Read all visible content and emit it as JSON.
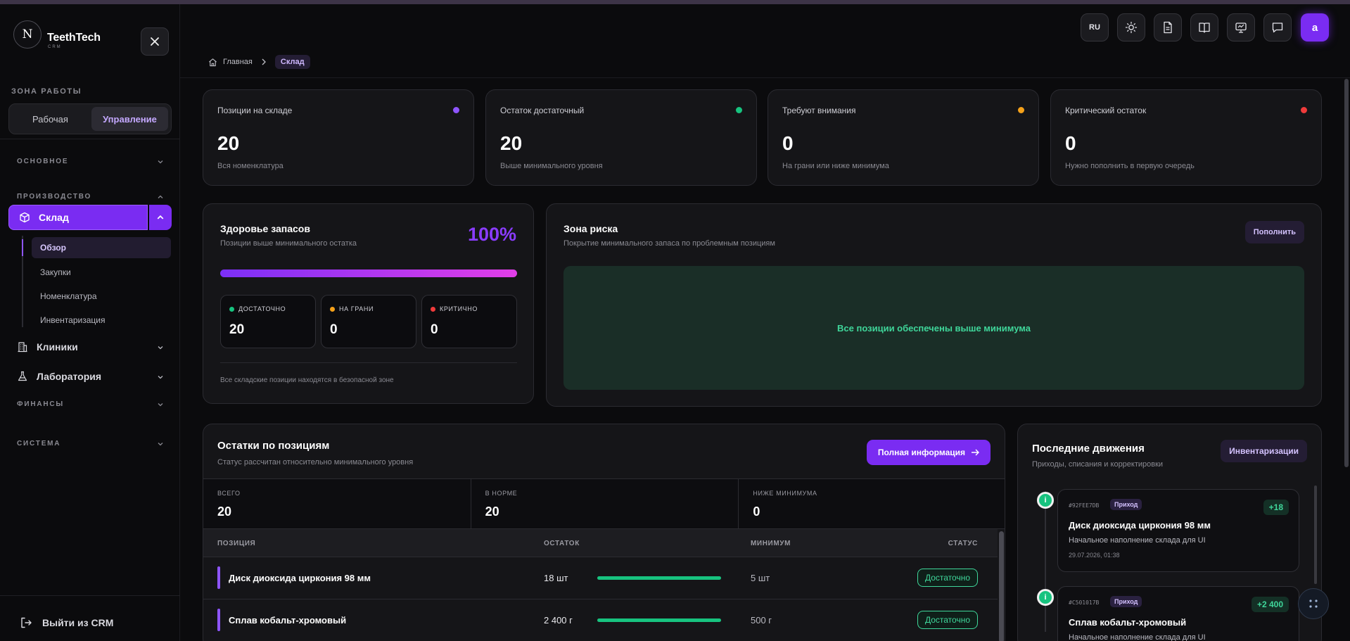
{
  "brand": {
    "name": "TeethTech",
    "sub": "CRM",
    "logo_letter": "N"
  },
  "sidebar": {
    "zone_title": "ЗОНА РАБОТЫ",
    "zone_tabs": [
      {
        "label": "Рабочая"
      },
      {
        "label": "Управление",
        "active": true
      }
    ],
    "groups": {
      "basic": "ОСНОВНОЕ",
      "production": "ПРОИЗВОДСТВО",
      "finance": "ФИНАНСЫ",
      "system": "СИСТЕМА"
    },
    "active_section": "Склад",
    "sub_items": [
      {
        "label": "Обзор",
        "active": true
      },
      {
        "label": "Закупки"
      },
      {
        "label": "Номенклатура"
      },
      {
        "label": "Инвентаризация"
      }
    ],
    "clinics": "Клиники",
    "laboratory": "Лаборатория",
    "logout": "Выйти из CRM"
  },
  "header": {
    "lang": "RU",
    "avatar_letter": "a",
    "icons": [
      "sun-icon",
      "document-icon",
      "book-icon",
      "monitor-icon",
      "chat-icon"
    ]
  },
  "breadcrumb": {
    "home": "Главная",
    "current": "Склад"
  },
  "stats": [
    {
      "label": "Позиции на складе",
      "value": "20",
      "hint": "Вся номенклатура",
      "color": "#8e55ff"
    },
    {
      "label": "Остаток достаточный",
      "value": "20",
      "hint": "Выше минимального уровня",
      "color": "#17c37f"
    },
    {
      "label": "Требуют внимания",
      "value": "0",
      "hint": "На грани или ниже минимума",
      "color": "#f5a11a"
    },
    {
      "label": "Критический остаток",
      "value": "0",
      "hint": "Нужно пополнить в первую очередь",
      "color": "#ef3b3b"
    }
  ],
  "health": {
    "title": "Здоровье запасов",
    "subtitle": "Позиции выше минимального остатка",
    "percent": "100%",
    "progress": 1.0,
    "boxes": [
      {
        "label": "ДОСТАТОЧНО",
        "value": "20",
        "color": "#17c37f"
      },
      {
        "label": "НА ГРАНИ",
        "value": "0",
        "color": "#f5a11a"
      },
      {
        "label": "КРИТИЧНО",
        "value": "0",
        "color": "#ef3b3b"
      }
    ],
    "note": "Все складские позиции находятся в безопасной зоне"
  },
  "risk": {
    "title": "Зона риска",
    "subtitle": "Покрытие минимального запаса по проблемным позициям",
    "button": "Пополнить",
    "message": "Все позиции обеспечены выше минимума"
  },
  "stock": {
    "title": "Остатки по позициям",
    "subtitle": "Статус рассчитан относительно минимального уровня",
    "button": "Полная информация",
    "summary": [
      {
        "label": "ВСЕГО",
        "value": "20"
      },
      {
        "label": "В НОРМЕ",
        "value": "20"
      },
      {
        "label": "НИЖЕ МИНИМУМА",
        "value": "0"
      }
    ],
    "columns": {
      "position": "ПОЗИЦИЯ",
      "stock": "ОСТАТОК",
      "min": "МИНИМУМ",
      "status": "СТАТУС"
    },
    "rows": [
      {
        "name": "Диск диоксида циркония 98 мм",
        "qty": "18 шт",
        "level": 1.0,
        "min": "5 шт",
        "status": "Достаточно"
      },
      {
        "name": "Сплав кобальт-хромовый",
        "qty": "2 400 г",
        "level": 1.0,
        "min": "500 г",
        "status": "Достаточно"
      }
    ]
  },
  "movements": {
    "title": "Последние движения",
    "subtitle": "Приходы, списания и корректировки",
    "button": "Инвентаризации",
    "items": [
      {
        "id": "#92FEE7DB",
        "type": "Приход",
        "delta": "+18",
        "name": "Диск диоксида циркония 98 мм",
        "note": "Начальное наполнение склада для UI",
        "date": "29.07.2026, 01:38"
      },
      {
        "id": "#C501017B",
        "type": "Приход",
        "delta": "+2 400",
        "name": "Сплав кобальт-хромовый",
        "note": "Начальное наполнение склада для UI",
        "date": ""
      }
    ]
  }
}
